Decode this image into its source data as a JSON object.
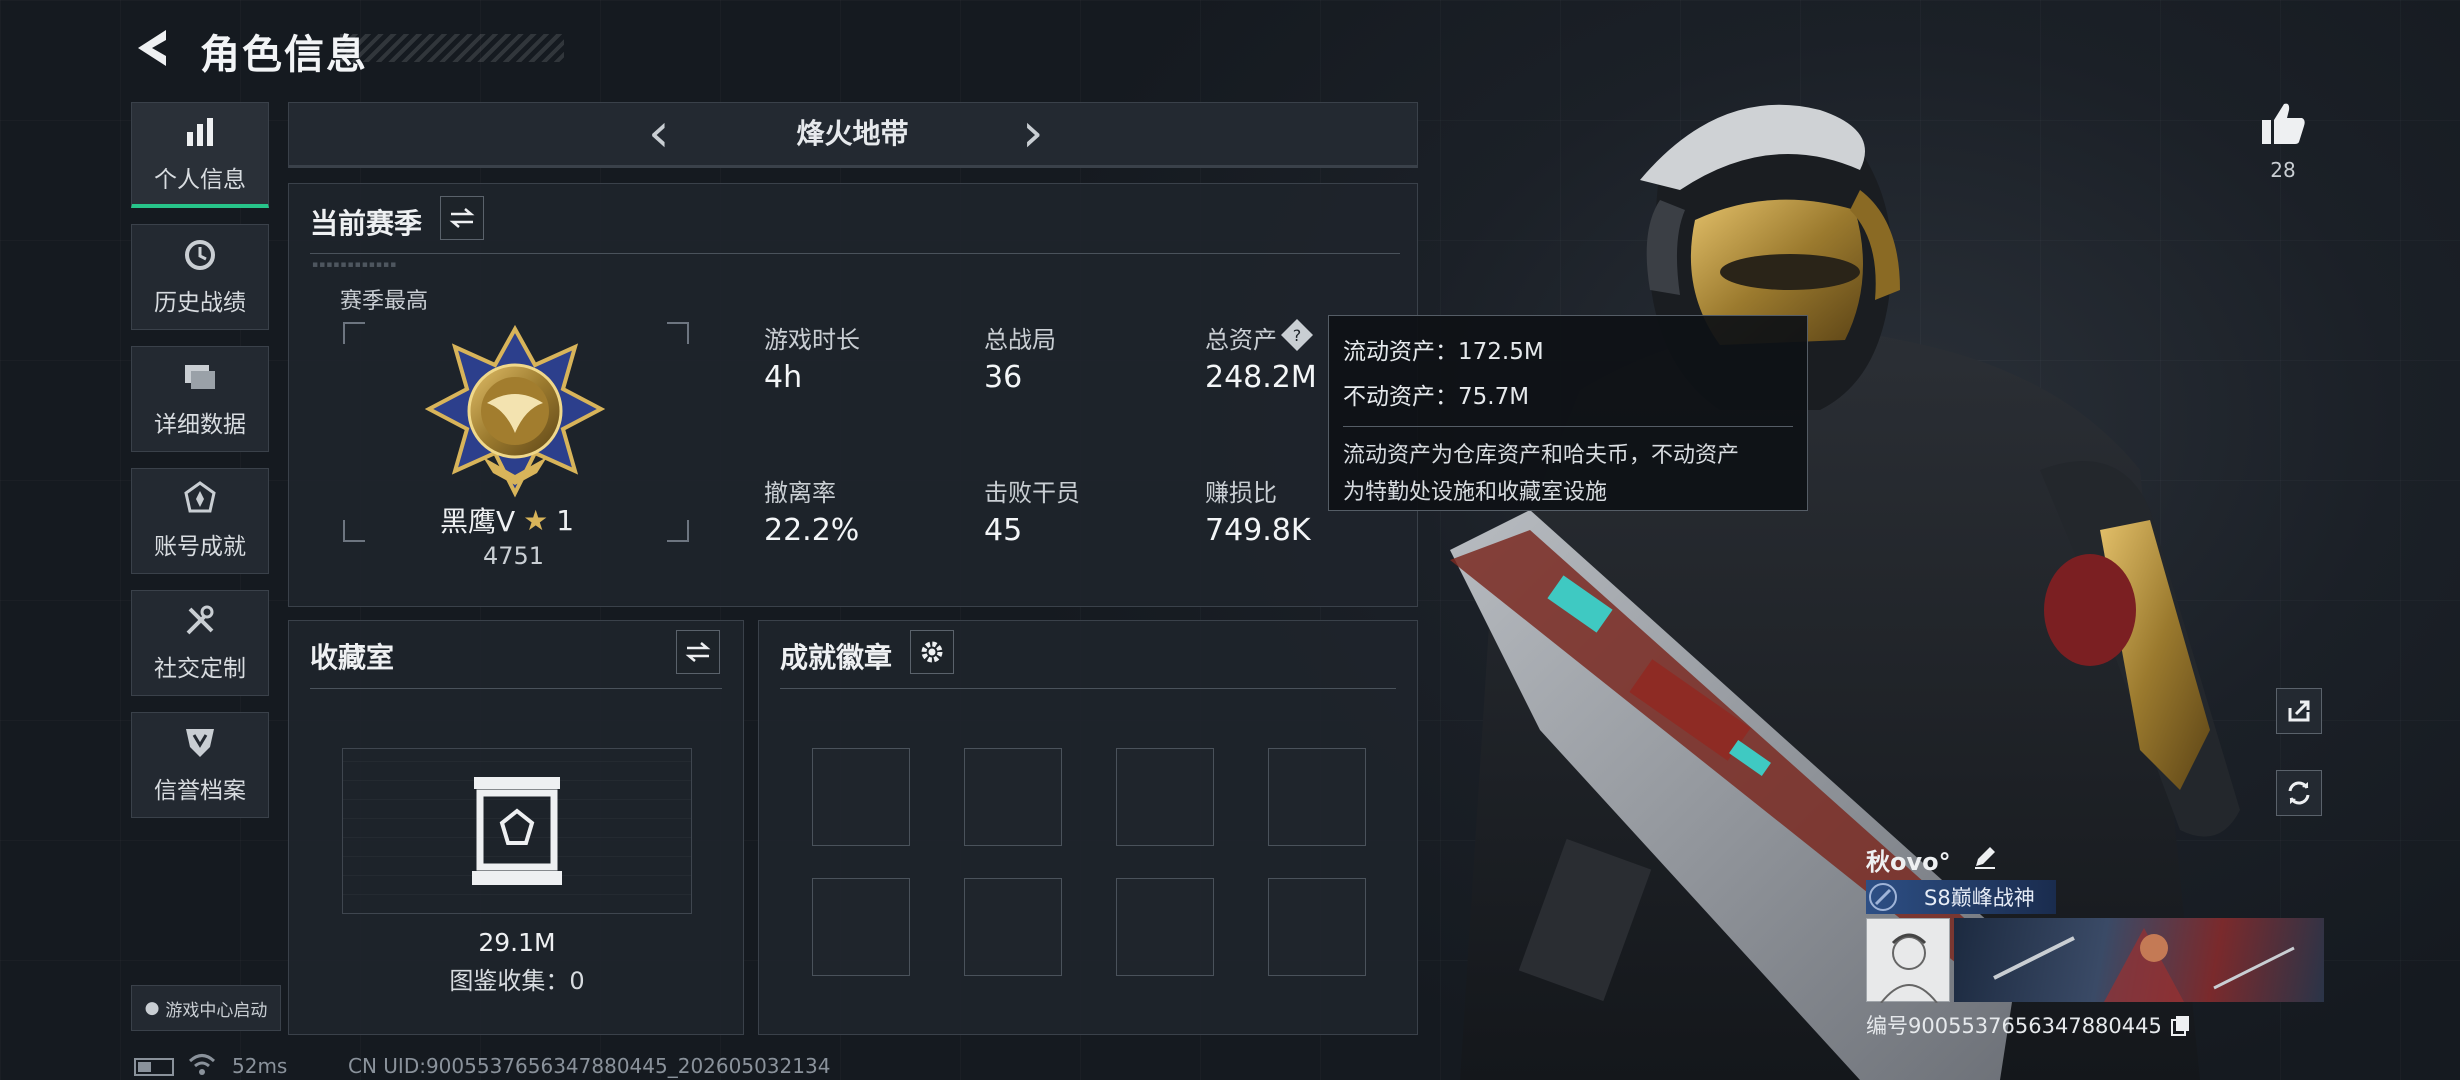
{
  "header": {
    "title": "角色信息"
  },
  "sidebar": {
    "items": [
      {
        "label": "个人信息",
        "icon": "bar-chart-icon",
        "active": true
      },
      {
        "label": "历史战绩",
        "icon": "history-icon"
      },
      {
        "label": "详细数据",
        "icon": "folder-icon"
      },
      {
        "label": "账号成就",
        "icon": "achievement-icon"
      },
      {
        "label": "社交定制",
        "icon": "tools-icon"
      },
      {
        "label": "信誉档案",
        "icon": "shield-icon"
      }
    ],
    "launcher": "游戏中心启动"
  },
  "mode": {
    "name": "烽火地带"
  },
  "season": {
    "title": "当前赛季",
    "best_label": "赛季最高",
    "rank_name": "黑鹰V",
    "rank_star": "1",
    "rank_score": "4751",
    "stats": [
      {
        "label": "游戏时长",
        "value": "4h"
      },
      {
        "label": "总战局",
        "value": "36"
      },
      {
        "label": "总资产",
        "value": "248.2M"
      },
      {
        "label": "撤离率",
        "value": "22.2%"
      },
      {
        "label": "击败干员",
        "value": "45"
      },
      {
        "label": "赚损比",
        "value": "749.8K"
      }
    ]
  },
  "tooltip": {
    "liquid": "流动资产：172.5M",
    "fixed": "不动资产：75.7M",
    "desc1": "流动资产为仓库资产和哈夫币，不动资产",
    "desc2": "为特勤处设施和收藏室设施"
  },
  "collection": {
    "title": "收藏室",
    "value": "29.1M",
    "catalog": "图鉴收集：0"
  },
  "badges": {
    "title": "成就徽章"
  },
  "likes": {
    "count": "28"
  },
  "player": {
    "name": "秋ovo°",
    "title": "S8巅峰战神",
    "id": "编号9005537656347880445"
  },
  "status": {
    "ping": "52ms",
    "uid": "CN UID:9005537656347880445_202605032134"
  },
  "colors": {
    "accent": "#27c48a",
    "title_banner": "#25406a",
    "gold": "#d8b45a"
  }
}
